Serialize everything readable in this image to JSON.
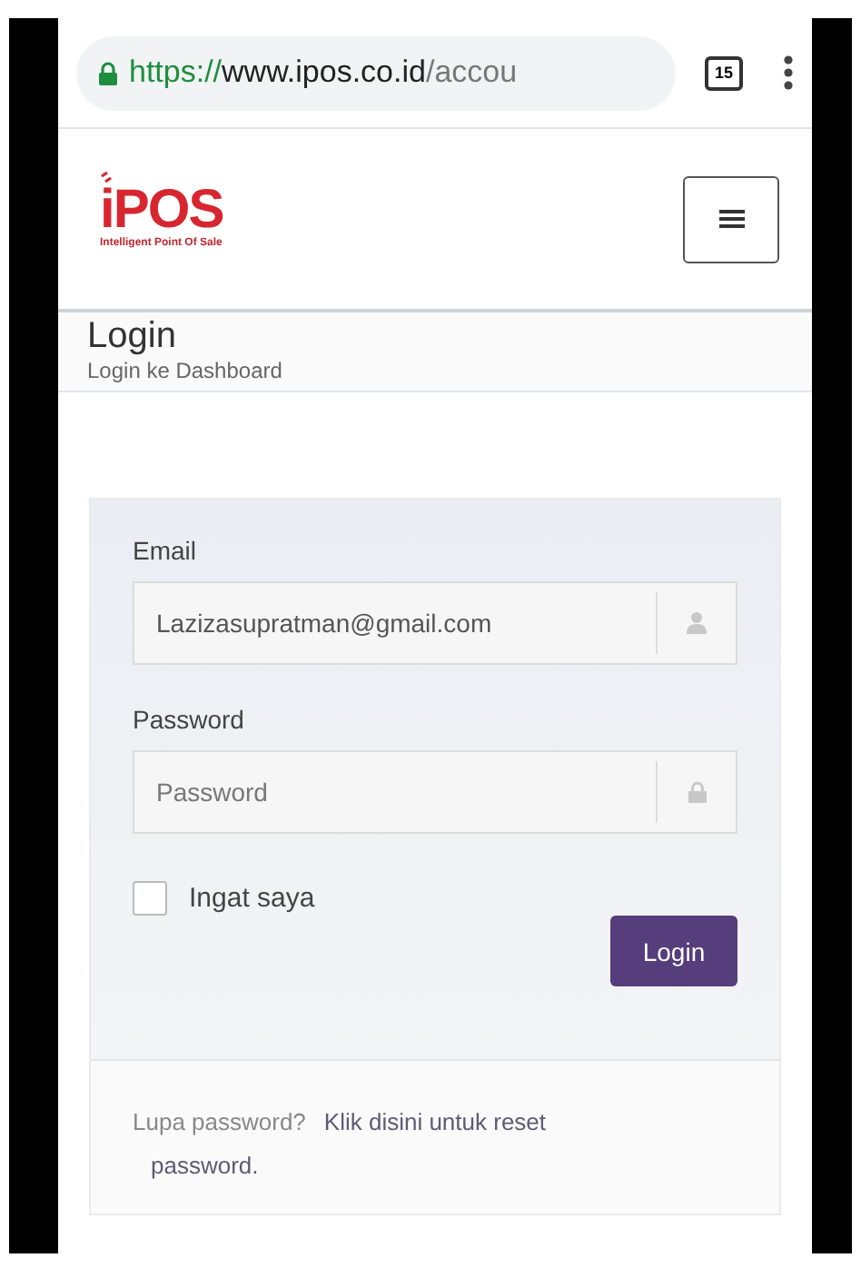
{
  "browser_bar": {
    "url_scheme": "https://",
    "url_host": "www.ipos.co.id",
    "url_path": "/accou",
    "tab_count": "15"
  },
  "header": {
    "logo": "POS",
    "logo_prefix": "i",
    "tagline": "Intelligent Point Of Sale"
  },
  "page_heading": {
    "title": "Login",
    "subtitle": "Login ke Dashboard"
  },
  "login_form": {
    "email_label": "Email",
    "email_value": "Lazizasupratman@gmail.com",
    "password_label": "Password",
    "password_placeholder": "Password",
    "remember": {
      "label": "Ingat saya",
      "checked": false
    },
    "submit": "Login"
  },
  "footer": {
    "question": "Lupa password?",
    "reset_link_lines": [
      "Klik disini untuk reset",
      "password."
    ]
  }
}
